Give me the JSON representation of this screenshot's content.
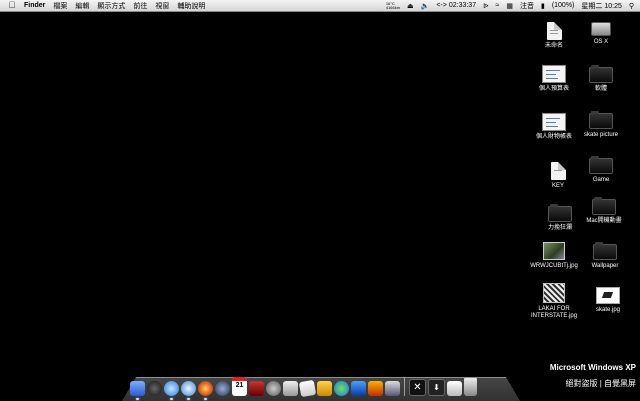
{
  "menubar": {
    "apple_icon": "apple-icon",
    "app_name": "Finder",
    "items": [
      "檔案",
      "編輯",
      "顯示方式",
      "前往",
      "視窗",
      "輔助說明"
    ],
    "weather_line1": "16°C",
    "weather_line2": "4166km",
    "timer": "<-> 02:33:37",
    "input_method": "注音",
    "battery": "(100%)",
    "clock": "星期二 10:25"
  },
  "desktop": {
    "items": [
      {
        "label": "未命名",
        "kind": "doc"
      },
      {
        "label": "OS X",
        "kind": "drive"
      },
      {
        "label": "個人預算表",
        "kind": "sheet"
      },
      {
        "label": "軟體",
        "kind": "folder"
      },
      {
        "label": "個人財物帳表",
        "kind": "sheet"
      },
      {
        "label": "skate picture",
        "kind": "folder"
      },
      {
        "label": "KEY",
        "kind": "doc"
      },
      {
        "label": "Game",
        "kind": "folder"
      },
      {
        "label": "力挽狂瀾",
        "kind": "folder"
      },
      {
        "label": "Mac開機動畫",
        "kind": "folder"
      },
      {
        "label": "WRWJCUBtTj.jpg",
        "kind": "photo"
      },
      {
        "label": "Wallpaper",
        "kind": "folder"
      },
      {
        "label": "LAKAI FOR INTERSTATE.jpg",
        "kind": "photo"
      },
      {
        "label": "skate.jpg",
        "kind": "photo"
      }
    ]
  },
  "watermark": {
    "line1": "Microsoft Windows XP",
    "line2": "絕對盜版 | 自覺黑屏"
  },
  "dock": {
    "apps": [
      "finder-icon",
      "dashboard-icon",
      "itunes-icon",
      "safari-icon",
      "firefox-icon",
      "quicktime-icon",
      "ical-icon",
      "photo-booth-icon",
      "system-preferences-icon",
      "preview-icon",
      "textedit-icon",
      "imovie-icon",
      "messenger-icon",
      "folder-app-icon",
      "garageband-icon",
      "installer-icon"
    ],
    "stacks": [
      "x11-icon",
      "downloads-stack-icon",
      "mail-stack-icon",
      "trash-icon"
    ]
  }
}
